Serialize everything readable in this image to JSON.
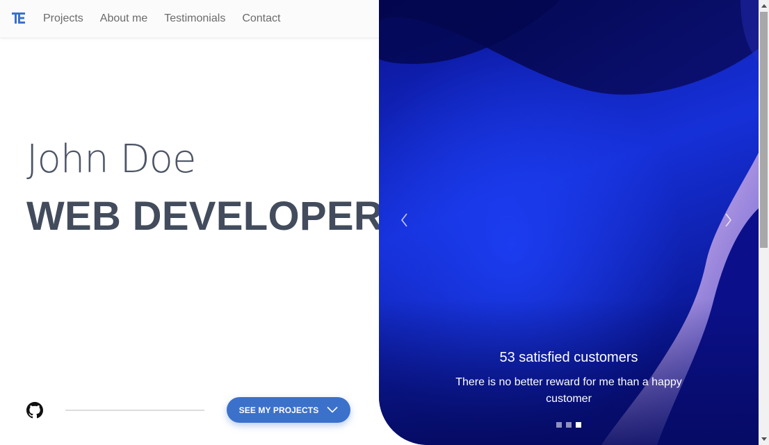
{
  "nav": {
    "logo_icon": "te-logo-icon",
    "links": [
      {
        "label": "Projects"
      },
      {
        "label": "About me"
      },
      {
        "label": "Testimonials"
      },
      {
        "label": "Contact"
      }
    ]
  },
  "hero": {
    "name": "John Doe",
    "role": "WEB DEVELOPER",
    "github_icon": "github-icon",
    "cta_label": "SEE MY PROJECTS",
    "cta_icon": "chevron-down-icon"
  },
  "carousel": {
    "caption_title": "53 satisfied customers",
    "caption_text": "There is no better reward for me than a happy customer",
    "slide_count": 3,
    "active_slide": 3
  },
  "colors": {
    "accent": "#3b71ca",
    "heading": "#4d5566",
    "carousel_base": "#0b1a9e"
  }
}
